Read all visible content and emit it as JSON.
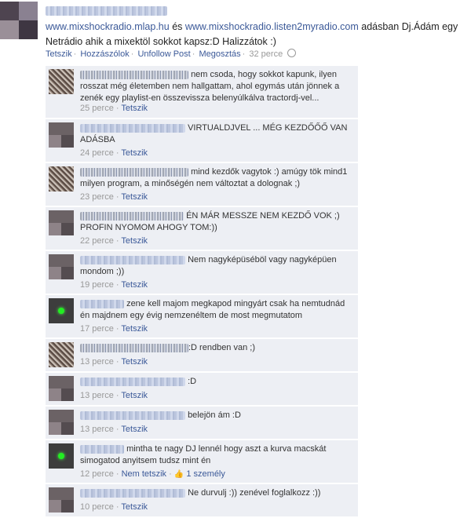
{
  "post": {
    "link1": "www.mixshockradio.mlap.hu",
    "connector": "és",
    "link2": "www.mixshockradio.listen2myradio.com",
    "text1": "adásban Dj.Ádám egy",
    "text2": "Netrádio ahik a mixektöl sokkot kapsz:D Halizzátok :)"
  },
  "actions": {
    "like": "Tetszik",
    "comment": "Hozzászólok",
    "unfollow": "Unfollow Post",
    "share": "Megosztás",
    "time": "32 perce"
  },
  "comments": [
    {
      "text": "nem csoda, hogy sokkot kapunk, ilyen rosszat még életemben nem hallgattam, ahol egymás után jönnek a zenék egy playlist-en összevissza belenyúlkálva tractordj-vel...",
      "time": "25 perce",
      "like": "Tetszik"
    },
    {
      "text": "VIRTUALDJVEL ... MÉG KEZDŐŐŐ VAN ADÁSBA",
      "time": "24 perce",
      "like": "Tetszik"
    },
    {
      "text": "mind kezdők vagytok :) amúgy tök mind1 milyen program, a minőségén nem változtat a dolognak ;)",
      "time": "23 perce",
      "like": "Tetszik"
    },
    {
      "text": "ÉN MÁR MESSZE NEM KEZDŐ VOK ;) PROFIN NYOMOM AHOGY TOM:))",
      "time": "22 perce",
      "like": "Tetszik"
    },
    {
      "text": "Nem nagyképüséböl vagy nagyképüen mondom ;))",
      "time": "19 perce",
      "like": "Tetszik"
    },
    {
      "text": "zene kell majom megkapod mingyárt csak ha nemtudnád én majdnem egy évig nemzenéltem de most megmutatom",
      "time": "17 perce",
      "like": "Tetszik"
    },
    {
      "text": ":D rendben van ;)",
      "time": "13 perce",
      "like": "Tetszik"
    },
    {
      "text": ":D",
      "time": "13 perce",
      "like": "Tetszik"
    },
    {
      "text": "belejön ám :D",
      "time": "13 perce",
      "like": "Tetszik"
    },
    {
      "text": "mintha te nagy DJ lennél hogy aszt a kurva macskát simogatod anyitsem tudsz mint én",
      "time": "12 perce",
      "like": "Nem tetszik",
      "likes_count": "1 személy"
    },
    {
      "text": "Ne durvulj :)) zenével foglalkozz :))",
      "time": "10 perce",
      "like": "Tetszik"
    }
  ]
}
